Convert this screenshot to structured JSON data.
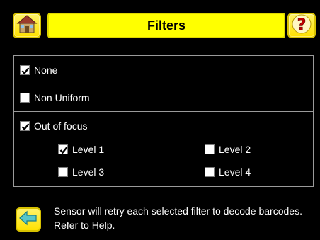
{
  "header": {
    "title": "Filters",
    "home_icon": "home-icon",
    "help_icon": "help-icon"
  },
  "options": {
    "none": {
      "label": "None",
      "checked": true
    },
    "non_uniform": {
      "label": "Non Uniform",
      "checked": false
    },
    "out_of_focus": {
      "label": "Out of focus",
      "checked": true,
      "levels": [
        {
          "label": "Level 1",
          "checked": true
        },
        {
          "label": "Level 2",
          "checked": false
        },
        {
          "label": "Level 3",
          "checked": false
        },
        {
          "label": "Level 4",
          "checked": false
        }
      ]
    }
  },
  "footer": {
    "back_icon": "back-arrow-icon",
    "message": "Sensor will retry each selected filter to decode barcodes. Refer to Help."
  },
  "colors": {
    "accent": "#ffff00",
    "background": "#000000",
    "text": "#ffffff",
    "separator": "#9a9a9a"
  }
}
